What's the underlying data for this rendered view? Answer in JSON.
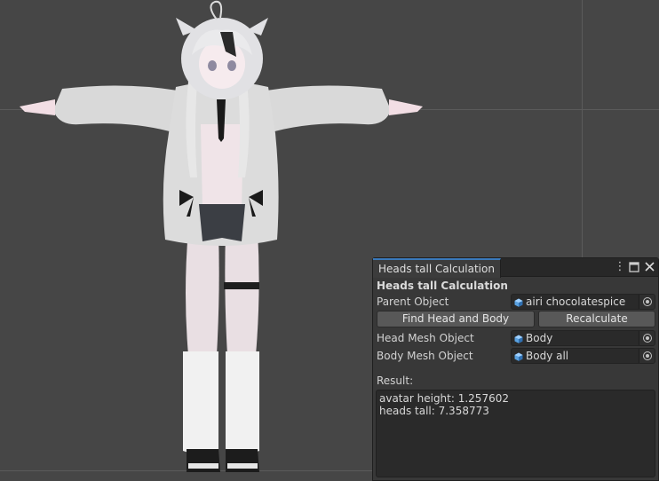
{
  "window": {
    "tab_title": "Heads tall Calculation",
    "menu_icon": "kebab-menu-icon",
    "maximize_icon": "maximize-icon",
    "close_icon": "close-icon"
  },
  "panel": {
    "heading": "Heads tall Calculation",
    "parent_object": {
      "label": "Parent Object",
      "value": "airi chocolatespice",
      "icon": "gameobject-cube-icon"
    },
    "buttons": {
      "find": "Find Head and Body",
      "recalculate": "Recalculate"
    },
    "head_mesh": {
      "label": "Head Mesh Object",
      "value": "Body",
      "icon": "gameobject-cube-icon"
    },
    "body_mesh": {
      "label": "Body Mesh Object",
      "value": "Body all",
      "icon": "gameobject-cube-icon"
    },
    "result_label": "Result:",
    "result_lines": [
      "avatar height: 1.257602",
      "heads tall: 7.358773"
    ]
  },
  "colors": {
    "scene_background": "#464646",
    "panel_background": "#383838",
    "tab_accent": "#3a79bb",
    "button": "#585858",
    "field": "#2a2a2a"
  }
}
